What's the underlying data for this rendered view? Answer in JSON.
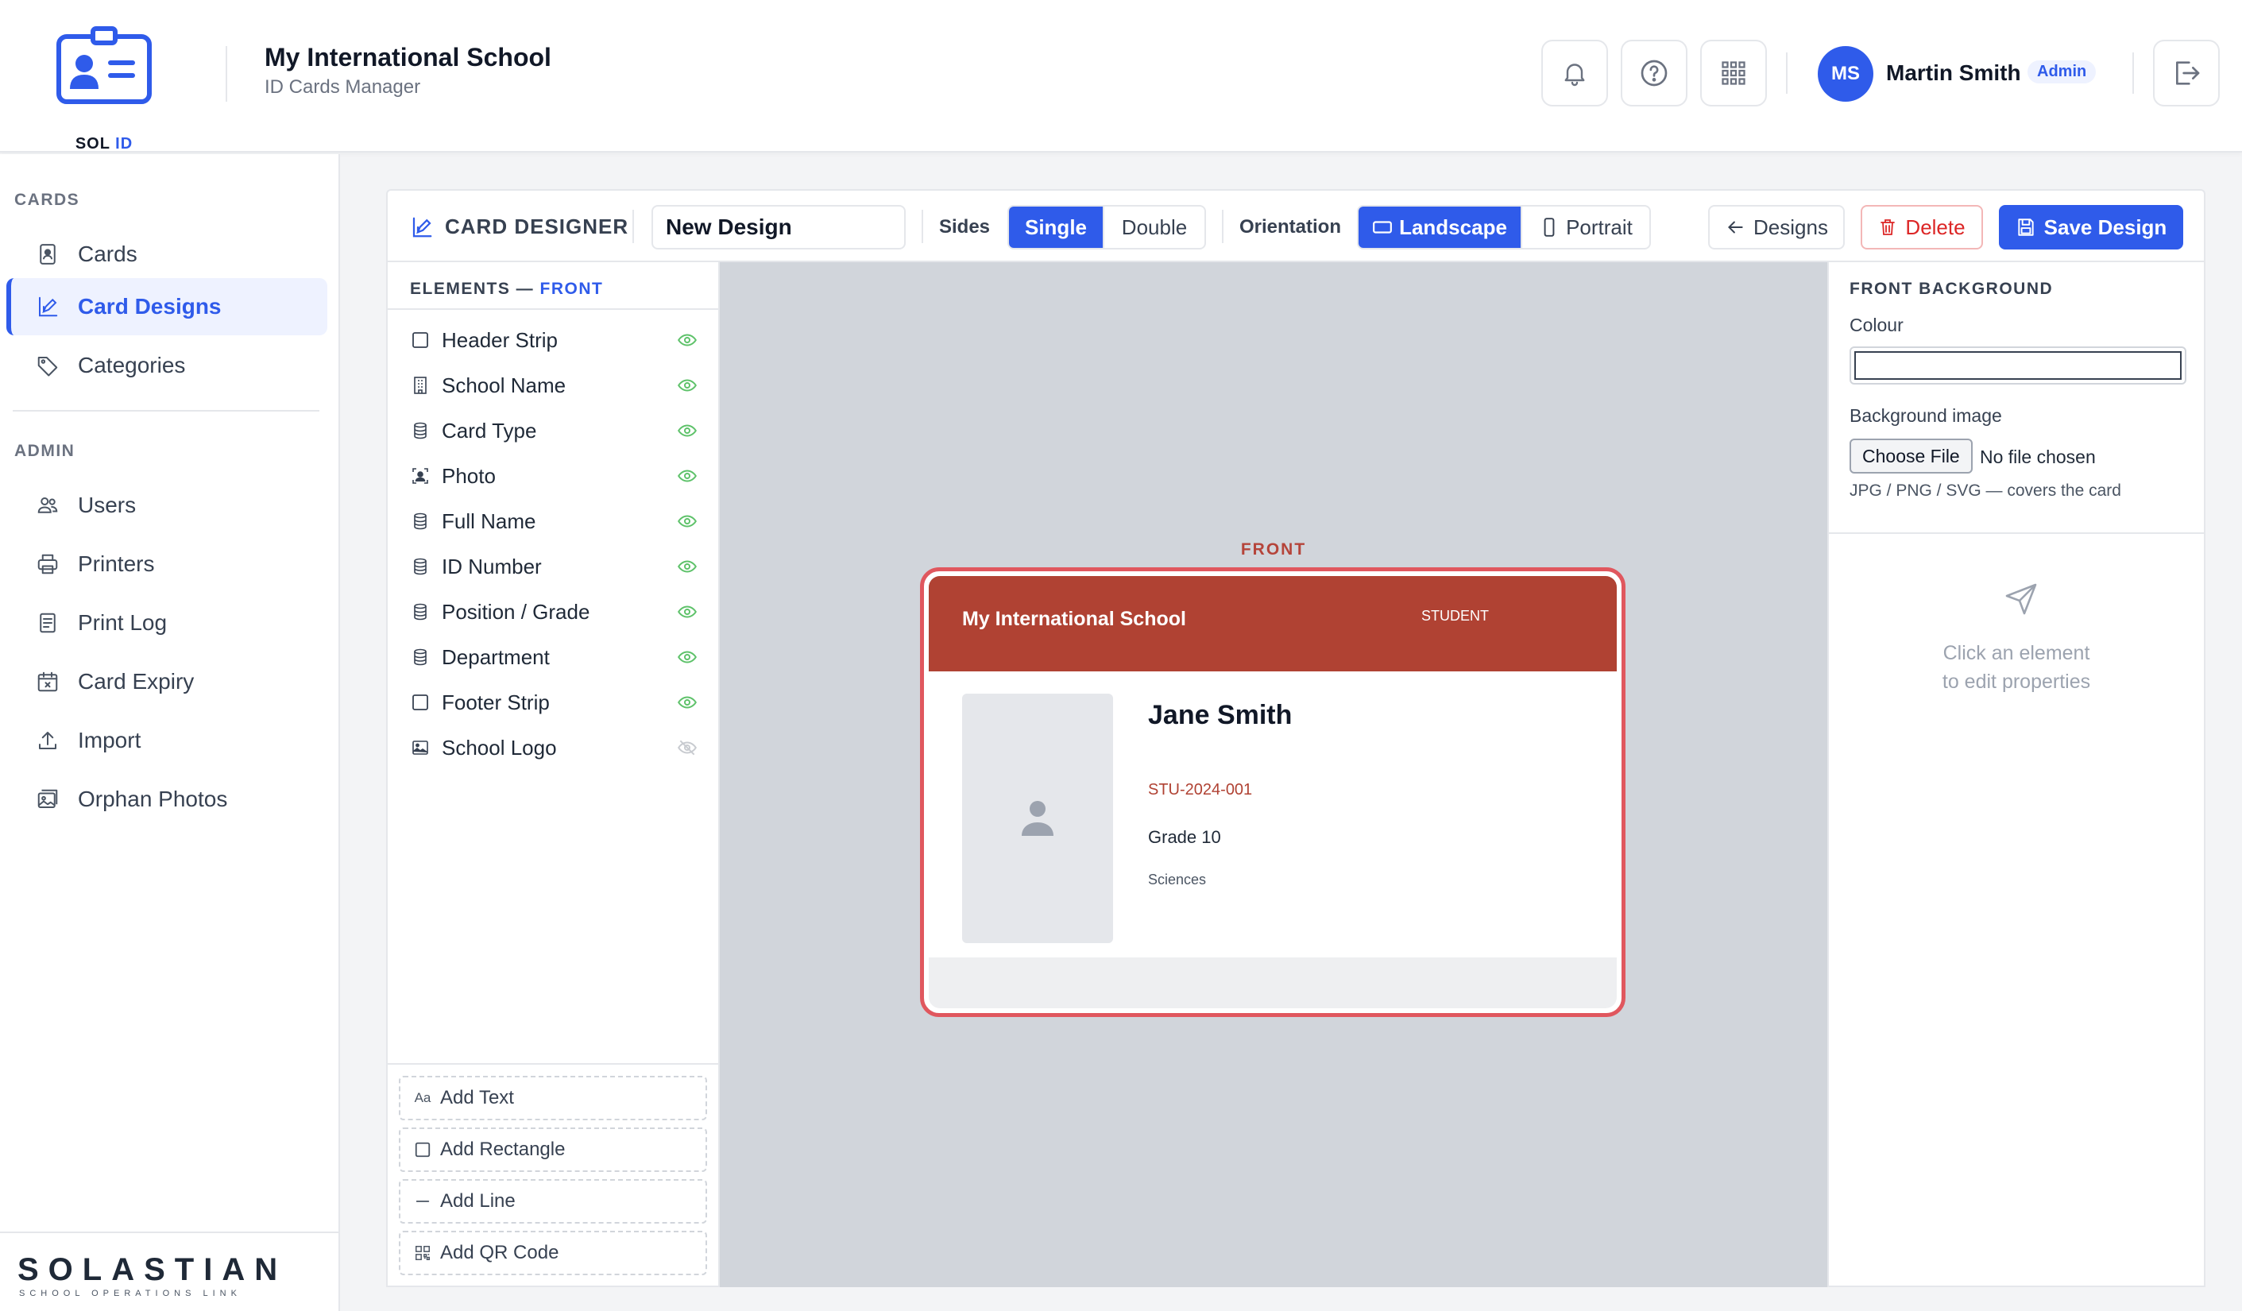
{
  "app": {
    "logo_text": "SOL",
    "logo_accent": "ID",
    "school_name": "My International School",
    "subtitle": "ID Cards Manager"
  },
  "header": {
    "icons": [
      "bell-icon",
      "help-icon",
      "apps-grid-icon",
      "logout-icon"
    ],
    "user": {
      "initials": "MS",
      "name": "Martin Smith",
      "role": "Admin"
    }
  },
  "sidebar": {
    "sections": [
      {
        "title": "CARDS",
        "items": [
          {
            "label": "Cards",
            "icon": "id-card-icon",
            "active": false
          },
          {
            "label": "Card Designs",
            "icon": "design-icon",
            "active": true
          },
          {
            "label": "Categories",
            "icon": "tag-icon",
            "active": false
          }
        ]
      },
      {
        "title": "ADMIN",
        "items": [
          {
            "label": "Users",
            "icon": "users-icon",
            "active": false
          },
          {
            "label": "Printers",
            "icon": "printer-icon",
            "active": false
          },
          {
            "label": "Print Log",
            "icon": "log-icon",
            "active": false
          },
          {
            "label": "Card Expiry",
            "icon": "calendar-x-icon",
            "active": false
          },
          {
            "label": "Import",
            "icon": "upload-icon",
            "active": false
          },
          {
            "label": "Orphan Photos",
            "icon": "photos-icon",
            "active": false
          }
        ]
      }
    ],
    "footer_brand": "SOLASTIAN",
    "footer_tagline": "SCHOOL OPERATIONS LINK"
  },
  "toolbar": {
    "title": "CARD DESIGNER",
    "design_name": "New Design",
    "sides_label": "Sides",
    "sides_options": [
      "Single",
      "Double"
    ],
    "sides_selected": "Single",
    "orientation_label": "Orientation",
    "orientation_options": [
      "Landscape",
      "Portrait"
    ],
    "orientation_selected": "Landscape",
    "designs_button": "Designs",
    "delete_button": "Delete",
    "save_button": "Save Design"
  },
  "elements_panel": {
    "heading": "ELEMENTS —",
    "side": "FRONT",
    "elements": [
      {
        "label": "Header Strip",
        "icon": "rectangle-icon",
        "visible": true
      },
      {
        "label": "School Name",
        "icon": "building-icon",
        "visible": true
      },
      {
        "label": "Card Type",
        "icon": "database-icon",
        "visible": true
      },
      {
        "label": "Photo",
        "icon": "photo-portrait-icon",
        "visible": true
      },
      {
        "label": "Full Name",
        "icon": "database-icon",
        "visible": true
      },
      {
        "label": "ID Number",
        "icon": "database-icon",
        "visible": true
      },
      {
        "label": "Position / Grade",
        "icon": "database-icon",
        "visible": true
      },
      {
        "label": "Department",
        "icon": "database-icon",
        "visible": true
      },
      {
        "label": "Footer Strip",
        "icon": "rectangle-icon",
        "visible": true
      },
      {
        "label": "School Logo",
        "icon": "image-icon",
        "visible": false
      }
    ],
    "add_buttons": [
      {
        "label": "Add Text",
        "icon": "text-icon",
        "glyph": "Aa"
      },
      {
        "label": "Add Rectangle",
        "icon": "rectangle-icon",
        "glyph": ""
      },
      {
        "label": "Add Line",
        "icon": "line-icon",
        "glyph": ""
      },
      {
        "label": "Add QR Code",
        "icon": "qr-code-icon",
        "glyph": ""
      }
    ]
  },
  "canvas": {
    "side_label": "FRONT",
    "card": {
      "school_name": "My International School",
      "card_type": "STUDENT",
      "full_name": "Jane Smith",
      "id_number": "STU-2024-001",
      "grade": "Grade 10",
      "department": "Sciences",
      "header_color": "#b04233",
      "selection_color": "#e0575e"
    }
  },
  "properties": {
    "heading": "FRONT BACKGROUND",
    "colour_label": "Colour",
    "colour_value": "#ffffff",
    "bg_image_label": "Background image",
    "file_button": "Choose File",
    "file_status": "No file chosen",
    "file_hint": "JPG / PNG / SVG — covers the card",
    "empty_hint_line1": "Click an element",
    "empty_hint_line2": "to edit properties"
  },
  "colors": {
    "accent": "#2f5bea",
    "danger": "#dc2626",
    "visible_eye": "#5ec26a",
    "hidden_eye": "#c8cbd0"
  }
}
